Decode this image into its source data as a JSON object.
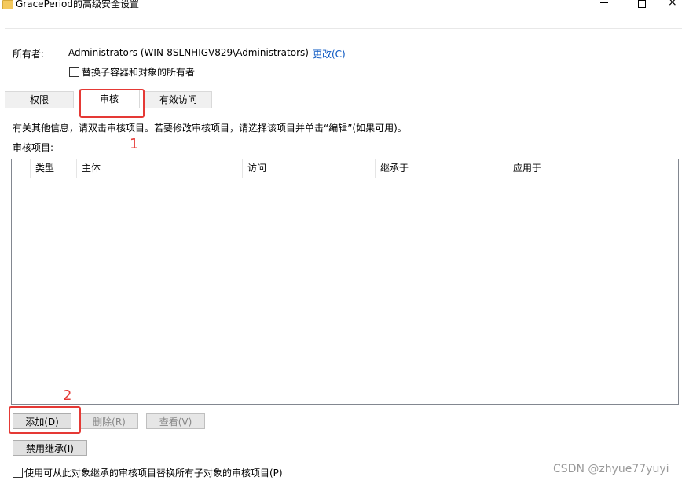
{
  "window": {
    "title": "GracePeriod的高级安全设置",
    "minimize_glyph": "",
    "maximize_glyph": "",
    "close_glyph": "×"
  },
  "owner": {
    "label": "所有者:",
    "value": "Administrators (WIN-8SLNHIGV829\\Administrators)",
    "change_link": "更改(C)"
  },
  "replace_owner": {
    "label": "替换子容器和对象的所有者",
    "checked": false
  },
  "tabs": [
    {
      "label": "权限",
      "active": false
    },
    {
      "label": "审核",
      "active": true
    },
    {
      "label": "有效访问",
      "active": false
    }
  ],
  "auditing": {
    "info_text": "有关其他信息，请双击审核项目。若要修改审核项目，请选择该项目并单击“编辑”(如果可用)。",
    "entries_label": "审核项目:",
    "columns": [
      "",
      "类型",
      "主体",
      "访问",
      "继承于",
      "应用于"
    ],
    "rows": []
  },
  "buttons": {
    "add": "添加(D)",
    "remove": "删除(R)",
    "view": "查看(V)",
    "disable_inheritance": "禁用继承(I)"
  },
  "replace_child": {
    "label": "使用可从此对象继承的审核项目替换所有子对象的审核项目(P)",
    "checked": false
  },
  "annotations": {
    "step1": "1",
    "step2": "2",
    "color": "#e53935"
  },
  "watermark": "CSDN @zhyue77yuyi"
}
